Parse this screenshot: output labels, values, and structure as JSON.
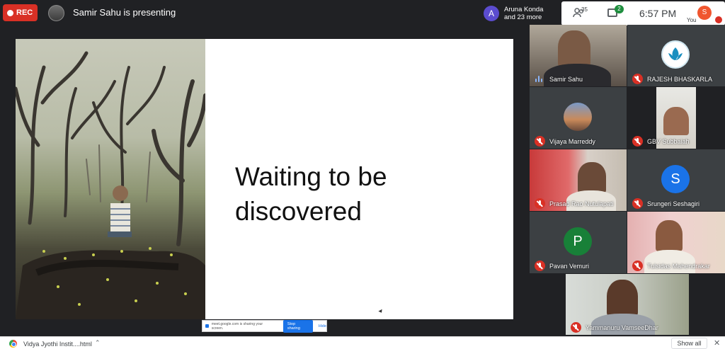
{
  "topbar": {
    "rec_label": "REC",
    "presenting_text": "Samir Sahu is presenting",
    "participant_initial": "A",
    "participant_line1": "Aruna Konda",
    "participant_line2": "and 23 more",
    "people_count": "35",
    "chat_badge": "2",
    "time": "6:57  PM",
    "user_initial": "S",
    "you_label": "You"
  },
  "slide": {
    "title": "Waiting to be discovered"
  },
  "share_bar": {
    "message": "meet.google.com is sharing your screen.",
    "stop_label": "Stop sharing",
    "hide_label": "Hide"
  },
  "tiles": [
    {
      "name": "Samir Sahu",
      "status": "speaking"
    },
    {
      "name": "RAJESH BHASKARLA",
      "status": "muted"
    },
    {
      "name": "Vijaya Marreddy",
      "status": "muted"
    },
    {
      "name": "GBV Subbaiah",
      "status": "muted"
    },
    {
      "name": "Prasad Rao Nutulapati",
      "status": "muted"
    },
    {
      "name": "Srungeri Seshagiri",
      "status": "muted",
      "initial": "S",
      "color": "#1a73e8"
    },
    {
      "name": "Pavan Vemuri",
      "status": "muted",
      "initial": "P",
      "color": "#188038"
    },
    {
      "name": "Tulsidas Mahendrakar",
      "status": "muted"
    },
    {
      "name": "Yammanuru VamseeDhar",
      "status": "muted"
    }
  ],
  "downloads": {
    "file_name": "Vidya Jyothi Instit....html",
    "show_all_label": "Show all"
  },
  "colors": {
    "record_red": "#d93025",
    "meet_green": "#1e8e3e",
    "background": "#202124"
  }
}
